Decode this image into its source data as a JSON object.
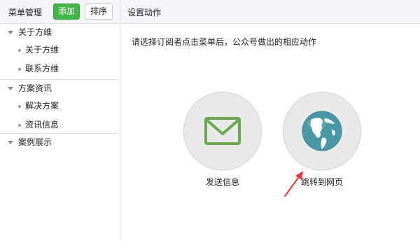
{
  "header": {
    "menu_title": "菜单管理",
    "add_label": "添加",
    "sort_label": "排序",
    "action_title": "设置动作"
  },
  "sidebar": {
    "groups": [
      {
        "label": "关于方维",
        "items": [
          "关于方维",
          "联系方维"
        ]
      },
      {
        "label": "方案资讯",
        "items": [
          "解决方案",
          "资讯信息"
        ]
      },
      {
        "label": "案例展示",
        "items": []
      }
    ]
  },
  "main": {
    "description": "请选择订阅者点击菜单后，公众号做出的相应动作",
    "actions": [
      {
        "label": "发送信息",
        "icon": "envelope-icon"
      },
      {
        "label": "跳转到网页",
        "icon": "globe-icon"
      }
    ]
  },
  "colors": {
    "accent_green": "#44b549",
    "envelope_green": "#6aa84f",
    "globe_teal": "#4a97a6",
    "annotation_red": "#e53935"
  }
}
